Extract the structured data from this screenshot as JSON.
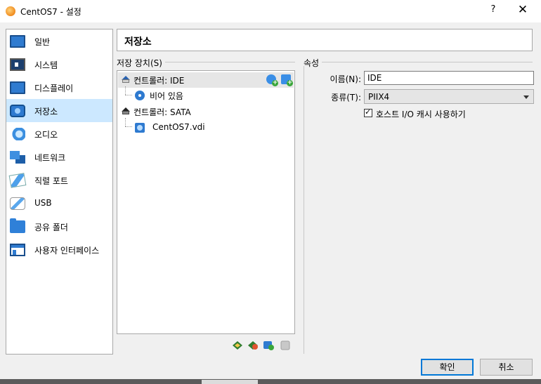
{
  "window": {
    "title": "CentOS7 - 설정",
    "help_glyph": "?",
    "close_glyph": "✕"
  },
  "sidebar": {
    "items": [
      {
        "label": "일반",
        "icon": "monitor-icon"
      },
      {
        "label": "시스템",
        "icon": "chip-icon"
      },
      {
        "label": "디스플레이",
        "icon": "display-icon"
      },
      {
        "label": "저장소",
        "icon": "storage-icon",
        "selected": true
      },
      {
        "label": "오디오",
        "icon": "speaker-icon"
      },
      {
        "label": "네트워크",
        "icon": "network-icon"
      },
      {
        "label": "직렬 포트",
        "icon": "serial-port-icon"
      },
      {
        "label": "USB",
        "icon": "usb-icon"
      },
      {
        "label": "공유 폴더",
        "icon": "folder-icon"
      },
      {
        "label": "사용자 인터페이스",
        "icon": "user-interface-icon"
      }
    ]
  },
  "page": {
    "title": "저장소"
  },
  "storage_devices": {
    "group_label": "저장 장치(S)",
    "tree": [
      {
        "label": "컨트롤러: IDE",
        "type": "controller"
      },
      {
        "label": "비어 있음",
        "type": "optical"
      },
      {
        "label": "컨트롤러: SATA",
        "type": "controller"
      },
      {
        "label": "CentOS7.vdi",
        "type": "disk"
      }
    ]
  },
  "attributes": {
    "group_label": "속성",
    "name_label": "이름(N):",
    "name_value": "IDE",
    "type_label": "종류(T):",
    "type_value": "PIIX4",
    "host_io_cache_label": "호스트 I/O 캐시 사용하기",
    "host_io_cache_checked": true
  },
  "buttons": {
    "ok": "확인",
    "cancel": "취소"
  }
}
